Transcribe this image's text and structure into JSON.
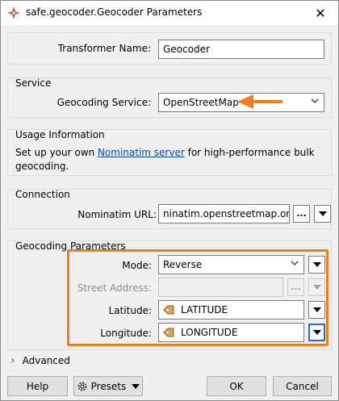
{
  "window": {
    "title": "safe.geocoder.Geocoder Parameters",
    "close_glyph": "✕"
  },
  "transformer": {
    "name_label": "Transformer Name:",
    "name_value": "Geocoder"
  },
  "service": {
    "group_title": "Service",
    "label": "Geocoding Service:",
    "value": "OpenStreetMap"
  },
  "usage": {
    "group_title": "Usage Information",
    "text_before": "Set up your own ",
    "link_text": "Nominatim server",
    "text_after_line1": " for high-performance bulk",
    "text_line2": "geocoding."
  },
  "connection": {
    "group_title": "Connection",
    "url_label": "Nominatim URL:",
    "url_value": "ninatim.openstreetmap.org/",
    "browse_glyph": "..."
  },
  "params": {
    "group_title": "Geocoding Parameters",
    "mode_label": "Mode:",
    "mode_value": "Reverse",
    "street_label": "Street Address:",
    "street_value": "",
    "street_browse_glyph": "...",
    "lat_label": "Latitude:",
    "lat_value": "LATITUDE",
    "lon_label": "Longitude:",
    "lon_value": "LONGITUDE"
  },
  "advanced": {
    "chevron": "›",
    "label": "Advanced"
  },
  "buttons": {
    "help": "Help",
    "presets": "Presets",
    "ok": "OK",
    "cancel": "Cancel"
  },
  "colors": {
    "highlight_orange": "#f07d1a",
    "link_blue": "#0645ad",
    "focus_blue": "#1a6fd1",
    "window_bg": "#f0f0f0"
  }
}
